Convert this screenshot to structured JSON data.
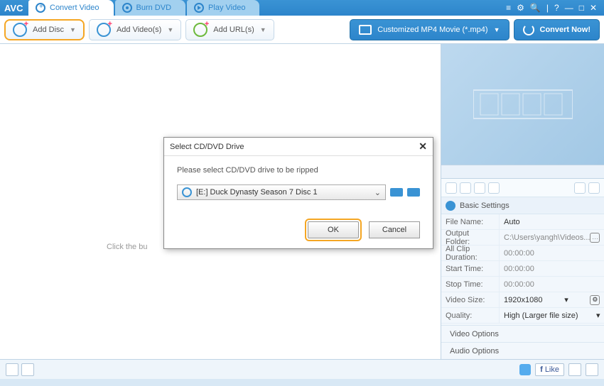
{
  "app": {
    "logo": "AVC"
  },
  "tabs": {
    "convert": "Convert Video",
    "burn": "Burn DVD",
    "play": "Play Video"
  },
  "toolbar": {
    "add_disc": "Add Disc",
    "add_videos": "Add Video(s)",
    "add_urls": "Add URL(s)",
    "profile": "Customized MP4 Movie (*.mp4)",
    "convert_now": "Convert Now!"
  },
  "content": {
    "placeholder": "Click the bu"
  },
  "dialog": {
    "title": "Select CD/DVD Drive",
    "message": "Please select CD/DVD drive to be ripped",
    "selected_drive": "[E:] Duck Dynasty Season 7 Disc 1",
    "ok": "OK",
    "cancel": "Cancel"
  },
  "sidebar": {
    "basic_settings": "Basic Settings",
    "video_options": "Video Options",
    "audio_options": "Audio Options",
    "rows": {
      "file_name": {
        "label": "File Name:",
        "value": "Auto"
      },
      "output_folder": {
        "label": "Output Folder:",
        "value": "C:\\Users\\yangh\\Videos..."
      },
      "all_clip_duration": {
        "label": "All Clip Duration:",
        "value": "00:00:00"
      },
      "start_time": {
        "label": "Start Time:",
        "value": "00:00:00"
      },
      "stop_time": {
        "label": "Stop Time:",
        "value": "00:00:00"
      },
      "video_size": {
        "label": "Video Size:",
        "value": "1920x1080"
      },
      "quality": {
        "label": "Quality:",
        "value": "High (Larger file size)"
      }
    }
  },
  "statusbar": {
    "like": "Like"
  }
}
